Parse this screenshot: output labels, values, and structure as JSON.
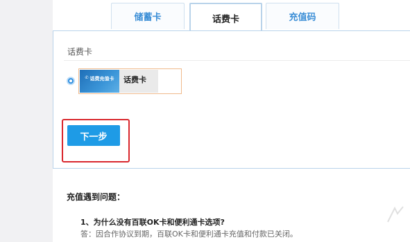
{
  "tabs": [
    {
      "label": "储蓄卡",
      "active": false
    },
    {
      "label": "话费卡",
      "active": true
    },
    {
      "label": "充值码",
      "active": false
    }
  ],
  "section_label": "话费卡",
  "card_option": {
    "thumb_text": "话费充值卡",
    "name": "话费卡",
    "selected": true
  },
  "next_button": "下一步",
  "faq": {
    "title": "充值遇到问题：",
    "question": "1、为什么没有百联OK卡和便利通卡选项?",
    "answer": "答：因合作协议到期，百联OK卡和便利通卡充值和付款已关闭。"
  },
  "colors": {
    "accent": "#1e9be6",
    "tab_text": "#3b8ed6",
    "highlight": "#d9262c",
    "card_border": "#f0b98a"
  }
}
